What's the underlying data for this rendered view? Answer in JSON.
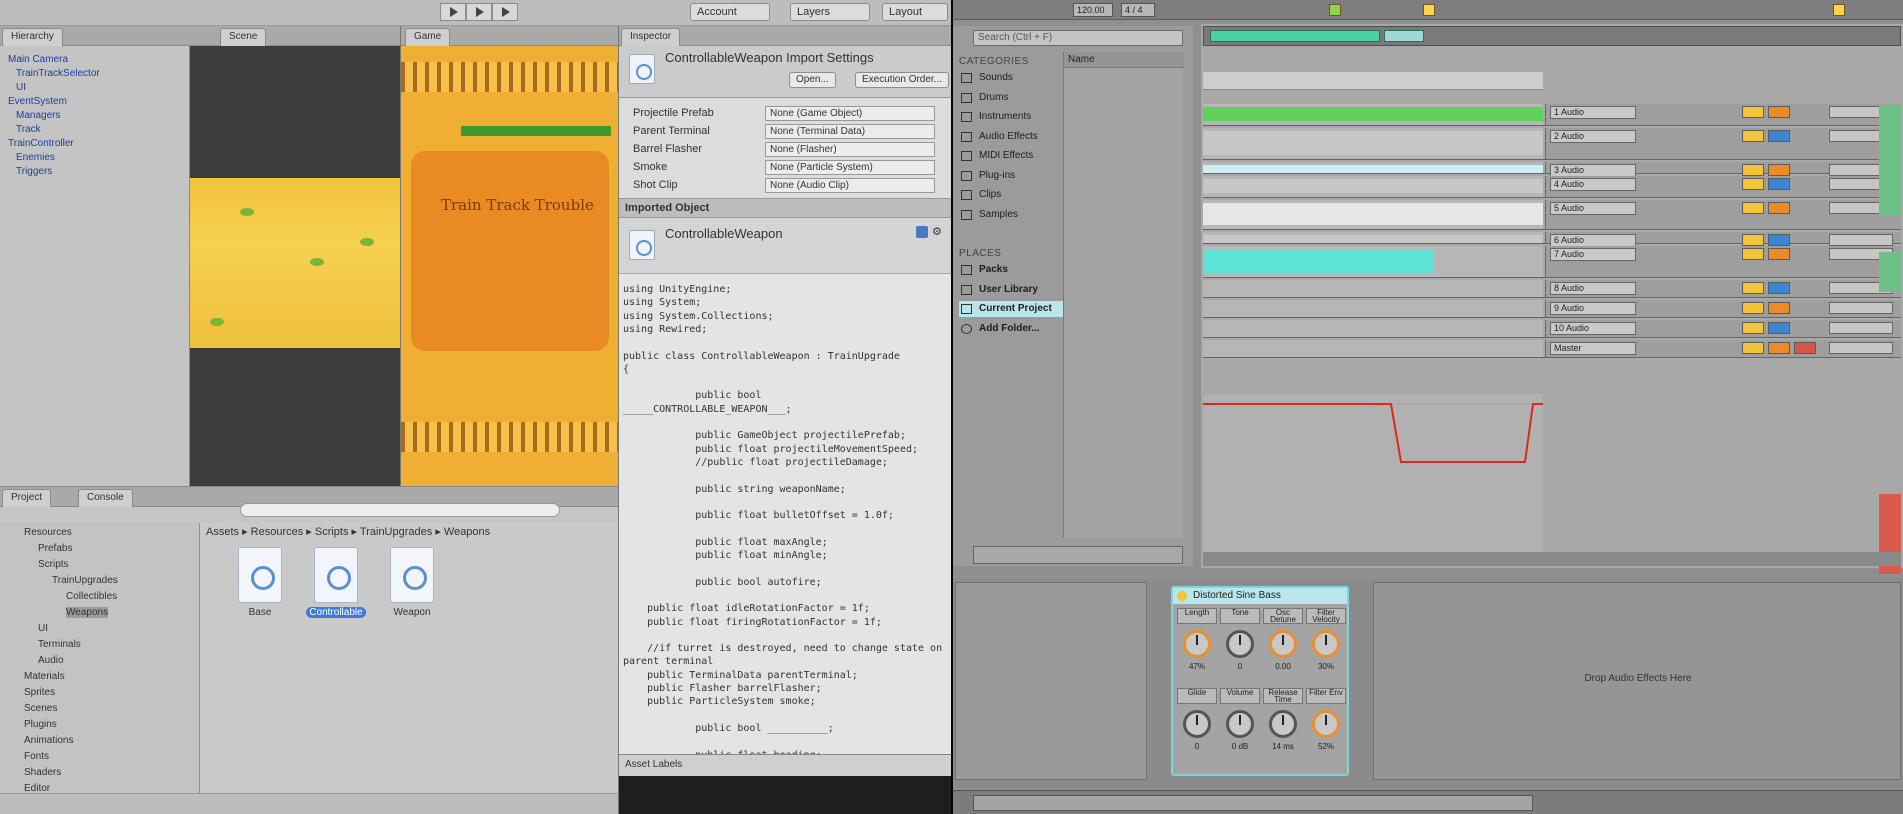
{
  "unity": {
    "toolbar": {
      "account_label": "Account",
      "layers_label": "Layers",
      "layout_label": "Layout"
    },
    "tabs": {
      "hierarchy": "Hierarchy",
      "scene": "Scene",
      "game": "Game",
      "inspector": "Inspector",
      "project": "Project",
      "console": "Console"
    },
    "hierarchy_items": [
      "Main Camera",
      "TrainTrackSelector",
      "UI",
      "EventSystem",
      "Managers",
      "Track",
      "TrainController",
      "Enemies",
      "Triggers"
    ],
    "game": {
      "title": "Train Track Trouble"
    },
    "inspector": {
      "import_title": "ControllableWeapon Import Settings",
      "open_button": "Open...",
      "execution_order_button": "Execution Order...",
      "fields": [
        {
          "label": "Projectile Prefab",
          "value": "None (Game Object)"
        },
        {
          "label": "Parent Terminal",
          "value": "None (Terminal Data)"
        },
        {
          "label": "Barrel Flasher",
          "value": "None (Flasher)"
        },
        {
          "label": "Smoke",
          "value": "None (Particle System)"
        },
        {
          "label": "Shot Clip",
          "value": "None (Audio Clip)"
        }
      ],
      "section_title": "Imported Object",
      "object_name": "ControllableWeapon",
      "code_lines": [
        "using UnityEngine;",
        "using System;",
        "using System.Collections;",
        "using Rewired;",
        "",
        "public class ControllableWeapon : TrainUpgrade",
        "{",
        "",
        "            public bool",
        "_____CONTROLLABLE_WEAPON___;",
        "",
        "            public GameObject projectilePrefab;",
        "            public float projectileMovementSpeed;",
        "            //public float projectileDamage;",
        "",
        "            public string weaponName;",
        "",
        "            public float bulletOffset = 1.0f;",
        "",
        "            public float maxAngle;",
        "            public float minAngle;",
        "",
        "            public bool autofire;",
        "",
        "    public float idleRotationFactor = 1f;",
        "    public float firingRotationFactor = 1f;",
        "",
        "    //if turret is destroyed, need to change state on",
        "parent terminal",
        "    public TerminalData parentTerminal;",
        "    public Flasher barrelFlasher;",
        "    public ParticleSystem smoke;",
        "",
        "            public bool __________;",
        "",
        "            public float heading;"
      ],
      "footer_label": "Asset Labels"
    },
    "project": {
      "breadcrumb": "Assets ▸ Resources ▸ Scripts ▸ TrainUpgrades ▸ Weapons",
      "tree_items": [
        "Resources",
        "Prefabs",
        "Scripts",
        "TrainUpgrades",
        "Collectibles",
        "Weapons",
        "UI",
        "Terminals",
        "Audio",
        "Materials",
        "Sprites",
        "Scenes",
        "Plugins",
        "Animations",
        "Fonts",
        "Shaders",
        "Editor"
      ],
      "assets": [
        {
          "name": "Base",
          "selected": false
        },
        {
          "name": "Controllable",
          "selected": true
        },
        {
          "name": "Weapon",
          "selected": false
        }
      ]
    }
  },
  "ableton": {
    "top": {
      "tempo": "120.00",
      "signature": "4 / 4"
    },
    "browser": {
      "search_placeholder": "Search (Ctrl + F)",
      "categories_heading": "CATEGORIES",
      "categories": [
        "Sounds",
        "Drums",
        "Instruments",
        "Audio Effects",
        "MIDI Effects",
        "Plug-ins",
        "Clips",
        "Samples"
      ],
      "places_heading": "PLACES",
      "places": [
        "Packs",
        "User Library",
        "Current Project",
        "Add Folder..."
      ],
      "selected_place": "Current Project",
      "list_header": "Name"
    },
    "tracks": [
      {
        "name": "1 Audio",
        "color": "#5fd05a"
      },
      {
        "name": "2 Audio",
        "color": "#c7c7c7"
      },
      {
        "name": "3 Audio",
        "color": "#cdeef4"
      },
      {
        "name": "4 Audio",
        "color": "#c7c7c7"
      },
      {
        "name": "5 Audio",
        "color": "#e6e6e6"
      },
      {
        "name": "6 Audio",
        "color": "#c7c7c7"
      },
      {
        "name": "7 Audio",
        "color": "#5fe2d6"
      },
      {
        "name": "8 Audio",
        "color": "#b6b6b6"
      },
      {
        "name": "9 Audio",
        "color": "#b6b6b6"
      },
      {
        "name": "10 Audio",
        "color": "#b6b6b6"
      },
      {
        "name": "Master",
        "color": "#b6b6b6"
      }
    ],
    "device": {
      "rack_title": "Distorted Sine Bass",
      "macros": [
        {
          "label": "Length",
          "value": "47%",
          "accent": true
        },
        {
          "label": "Tone",
          "value": "0",
          "accent": false
        },
        {
          "label": "Osc Detune",
          "value": "0.00",
          "accent": true
        },
        {
          "label": "Filter Velocity",
          "value": "30%",
          "accent": true
        },
        {
          "label": "Glide",
          "value": "0",
          "accent": false
        },
        {
          "label": "Volume",
          "value": "0 dB",
          "accent": false
        },
        {
          "label": "Release Time",
          "value": "14 ms",
          "accent": false
        },
        {
          "label": "Filter Env",
          "value": "52%",
          "accent": true
        }
      ],
      "drop_text": "Drop Audio Effects Here"
    }
  }
}
